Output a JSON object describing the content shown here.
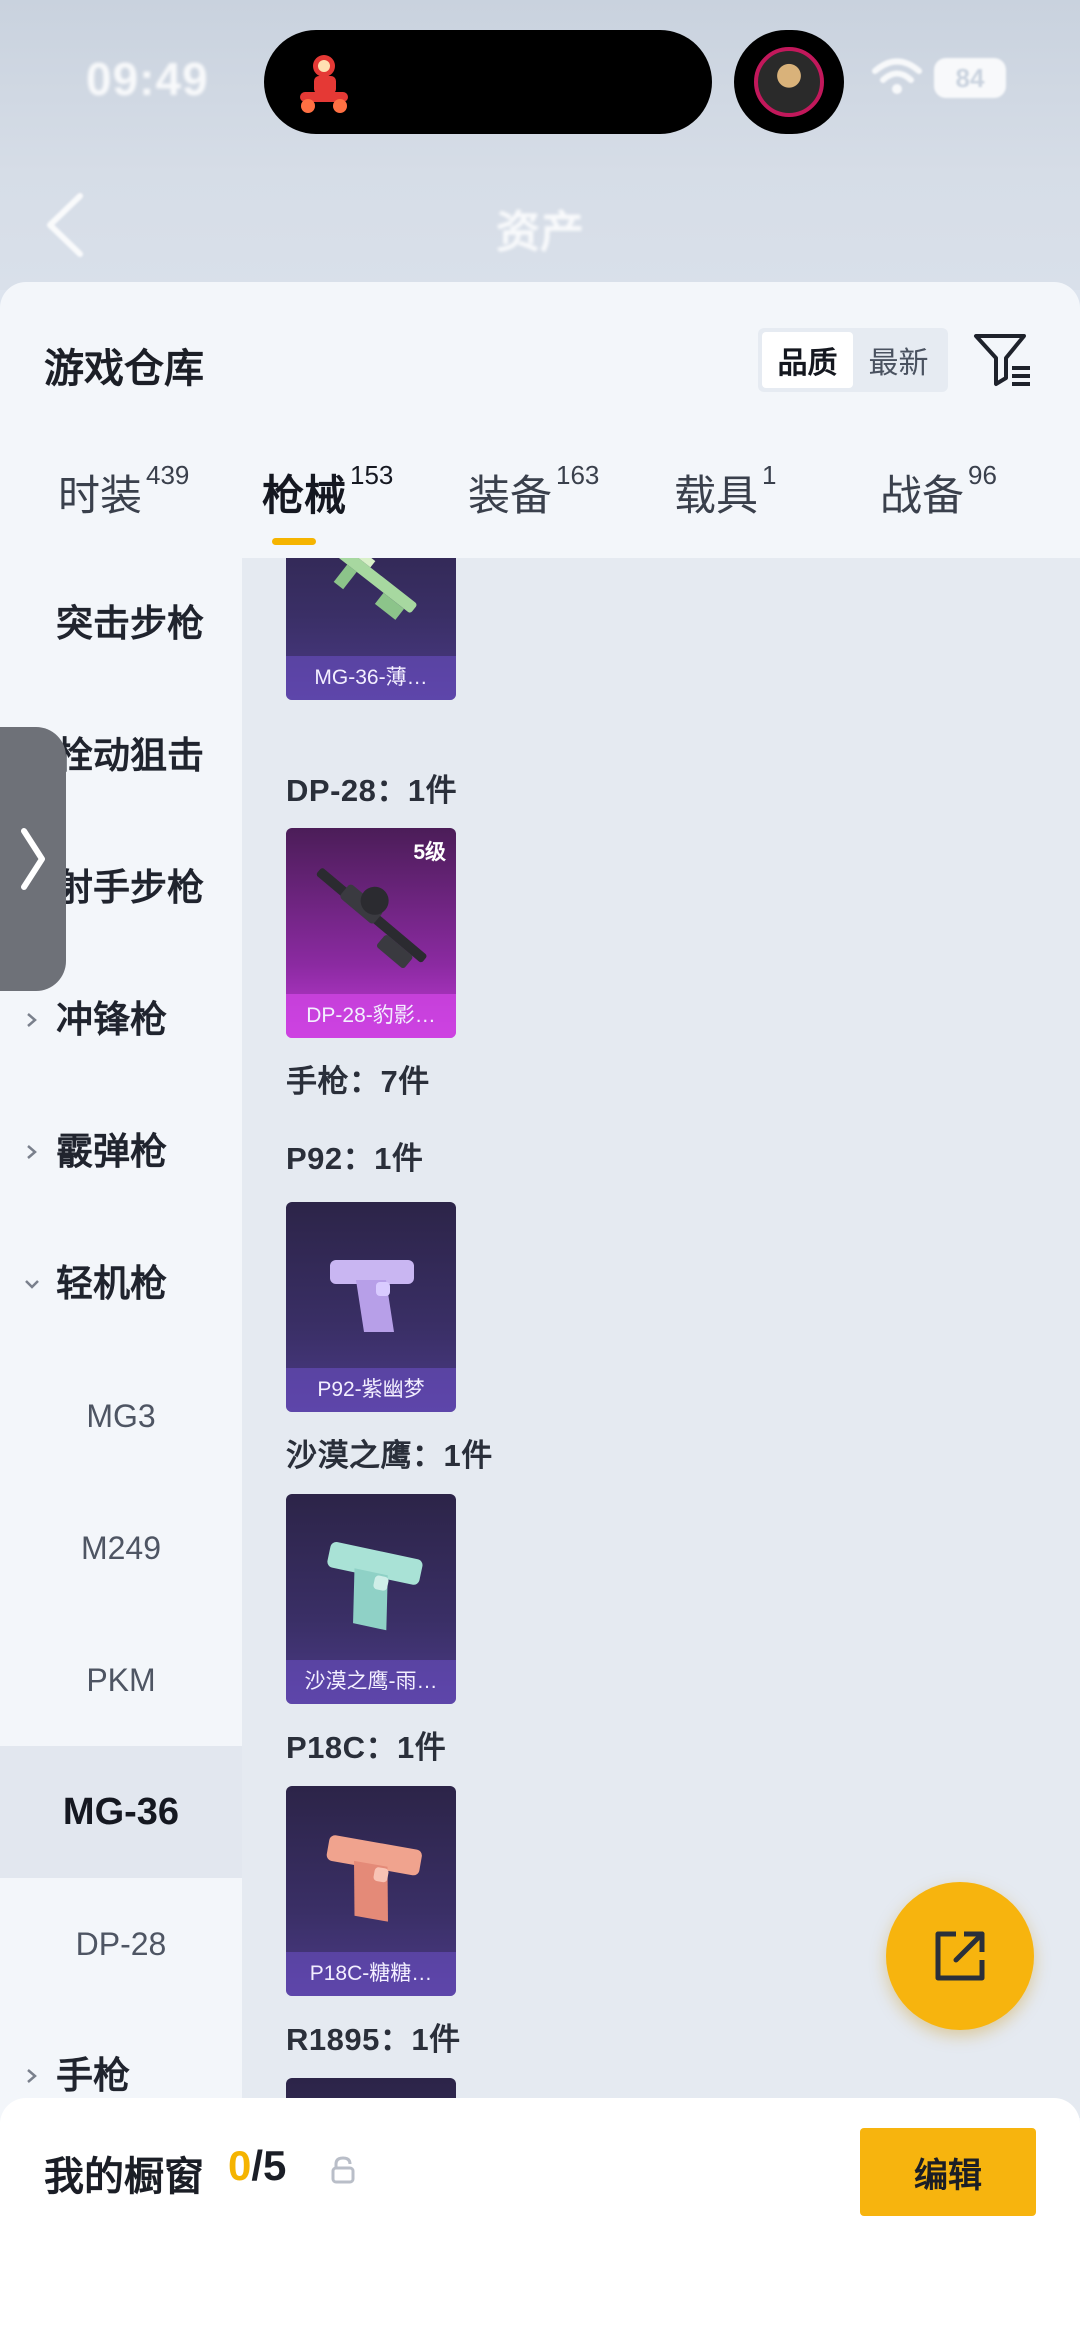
{
  "status_bar": {
    "time": "09:49",
    "battery": "84"
  },
  "header": {
    "title": "资产"
  },
  "panel": {
    "title": "游戏仓库"
  },
  "sort": {
    "options": [
      "品质",
      "最新"
    ],
    "active": "品质"
  },
  "tabs": [
    {
      "label": "时装",
      "count": "439"
    },
    {
      "label": "枪械",
      "count": "153",
      "active": true
    },
    {
      "label": "装备",
      "count": "163"
    },
    {
      "label": "载具",
      "count": "1"
    },
    {
      "label": "战备",
      "count": "96"
    }
  ],
  "sidebar": {
    "categories": [
      {
        "label": "突击步枪"
      },
      {
        "label": "栓动狙击"
      },
      {
        "label": "射手步枪"
      },
      {
        "label": "冲锋枪"
      },
      {
        "label": "霰弹枪"
      },
      {
        "label": "轻机枪",
        "expanded": true
      }
    ],
    "subitems": [
      "MG3",
      "M249",
      "PKM",
      "MG-36",
      "DP-28"
    ],
    "selected_subitem": "MG-36",
    "last_category": {
      "label": "手枪"
    }
  },
  "content": {
    "groups": [
      {
        "title": "DP-28：1件"
      },
      {
        "title": "手枪：7件"
      },
      {
        "title": "P92：1件"
      },
      {
        "title": "沙漠之鹰：1件"
      },
      {
        "title": "P18C：1件"
      },
      {
        "title": "R1895：1件"
      }
    ],
    "cards": [
      {
        "name": "MG-36-薄…",
        "icon": "rifle-icon"
      },
      {
        "name": "DP-28-豹影…",
        "level": "5级",
        "icon": "machine-gun-icon"
      },
      {
        "name": "P92-紫幽梦",
        "icon": "pistol-icon"
      },
      {
        "name": "沙漠之鹰-雨…",
        "icon": "pistol-icon"
      },
      {
        "name": "P18C-糖糖…",
        "icon": "pistol-icon"
      }
    ]
  },
  "showcase": {
    "label": "我的橱窗",
    "current": "0",
    "total": "/5",
    "edit_label": "编辑"
  },
  "colors": {
    "accent": "#f7b40e",
    "panel_bg": "#f3f6fa",
    "content_bg": "#e5eaf1"
  }
}
